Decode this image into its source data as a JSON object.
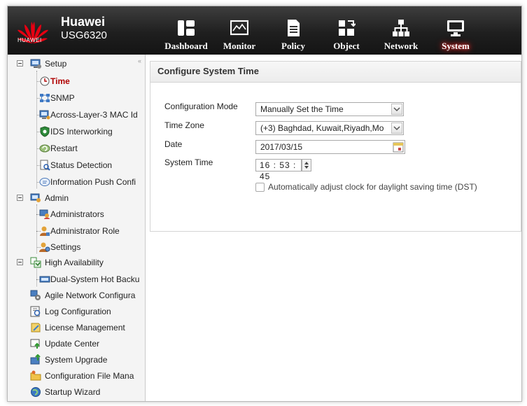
{
  "brand": {
    "name": "Huawei",
    "model": "USG6320",
    "logo_text": "HUAWEI"
  },
  "nav": [
    {
      "label": "Dashboard",
      "icon": "dashboard-icon",
      "active": false
    },
    {
      "label": "Monitor",
      "icon": "monitor-icon",
      "active": false
    },
    {
      "label": "Policy",
      "icon": "policy-icon",
      "active": false
    },
    {
      "label": "Object",
      "icon": "object-icon",
      "active": false
    },
    {
      "label": "Network",
      "icon": "network-icon",
      "active": false
    },
    {
      "label": "System",
      "icon": "system-icon",
      "active": true
    }
  ],
  "sidebar": {
    "collapse_glyph": "«",
    "groups": [
      {
        "label": "Setup",
        "icon": "setup-icon",
        "children": [
          {
            "label": "Time",
            "icon": "clock-icon",
            "selected": true
          },
          {
            "label": "SNMP",
            "icon": "snmp-icon"
          },
          {
            "label": "Across-Layer-3 MAC Id",
            "icon": "mac-icon"
          },
          {
            "label": "IDS Interworking",
            "icon": "ids-icon"
          },
          {
            "label": "Restart",
            "icon": "restart-icon"
          },
          {
            "label": "Status Detection",
            "icon": "status-detection-icon"
          },
          {
            "label": "Information Push Confi",
            "icon": "info-push-icon"
          }
        ]
      },
      {
        "label": "Admin",
        "icon": "admin-icon",
        "children": [
          {
            "label": "Administrators",
            "icon": "administrators-icon"
          },
          {
            "label": "Administrator Role",
            "icon": "admin-role-icon"
          },
          {
            "label": "Settings",
            "icon": "settings-icon"
          }
        ]
      },
      {
        "label": "High Availability",
        "icon": "ha-icon",
        "children": [
          {
            "label": "Dual-System Hot Backu",
            "icon": "hot-backup-icon"
          }
        ]
      }
    ],
    "leaves": [
      {
        "label": "Agile Network Configura",
        "icon": "agile-network-icon"
      },
      {
        "label": "Log Configuration",
        "icon": "log-config-icon"
      },
      {
        "label": "License Management",
        "icon": "license-icon"
      },
      {
        "label": "Update Center",
        "icon": "update-center-icon"
      },
      {
        "label": "System Upgrade",
        "icon": "system-upgrade-icon"
      },
      {
        "label": "Configuration File Mana",
        "icon": "config-file-icon"
      },
      {
        "label": "Startup Wizard",
        "icon": "startup-wizard-icon"
      }
    ]
  },
  "panel": {
    "title": "Configure System Time",
    "config_mode": {
      "label": "Configuration Mode",
      "value": "Manually Set the Time"
    },
    "time_zone": {
      "label": "Time Zone",
      "value": "(+3) Baghdad, Kuwait,Riyadh,Mo"
    },
    "date": {
      "label": "Date",
      "value": "2017/03/15"
    },
    "system_time": {
      "label": "System Time",
      "value": "16 : 53 : 45"
    },
    "dst": {
      "label": "Automatically adjust clock for daylight saving time (DST)",
      "checked": false
    }
  },
  "colors": {
    "header_bg": "#222222",
    "selected_text": "#b00000",
    "active_glow": "#ff2a2a"
  }
}
